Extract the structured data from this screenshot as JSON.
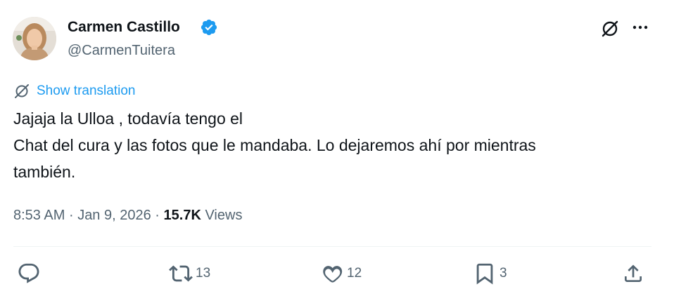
{
  "author": {
    "display_name": "Carmen Castillo",
    "handle": "@CarmenTuitera",
    "verified": true,
    "verified_color": "#1d9bf0"
  },
  "translation": {
    "label": "Show translation",
    "icon": "translate-icon",
    "color": "#1d9bf0"
  },
  "tweet": {
    "lines": [
      "Jajaja la Ulloa , todavía tengo el",
      "Chat del cura y las fotos que le mandaba. Lo dejaremos ahí por mientras",
      "también."
    ]
  },
  "meta": {
    "time": "8:53 AM",
    "separator": "·",
    "date": "Jan 9, 2026",
    "views_count": "15.7K",
    "views_label": "Views"
  },
  "actions": {
    "reply": {
      "icon": "reply-icon",
      "count": ""
    },
    "retweet": {
      "icon": "retweet-icon",
      "count": "13"
    },
    "like": {
      "icon": "heart-icon",
      "count": "12"
    },
    "bookmark": {
      "icon": "bookmark-icon",
      "count": "3"
    },
    "share": {
      "icon": "share-icon",
      "count": ""
    }
  },
  "header_icons": {
    "grok": "grok-icon",
    "more": "more-icon"
  },
  "colors": {
    "text_primary": "#0f1419",
    "text_secondary": "#536471",
    "accent": "#1d9bf0",
    "divider": "#eff3f4"
  }
}
